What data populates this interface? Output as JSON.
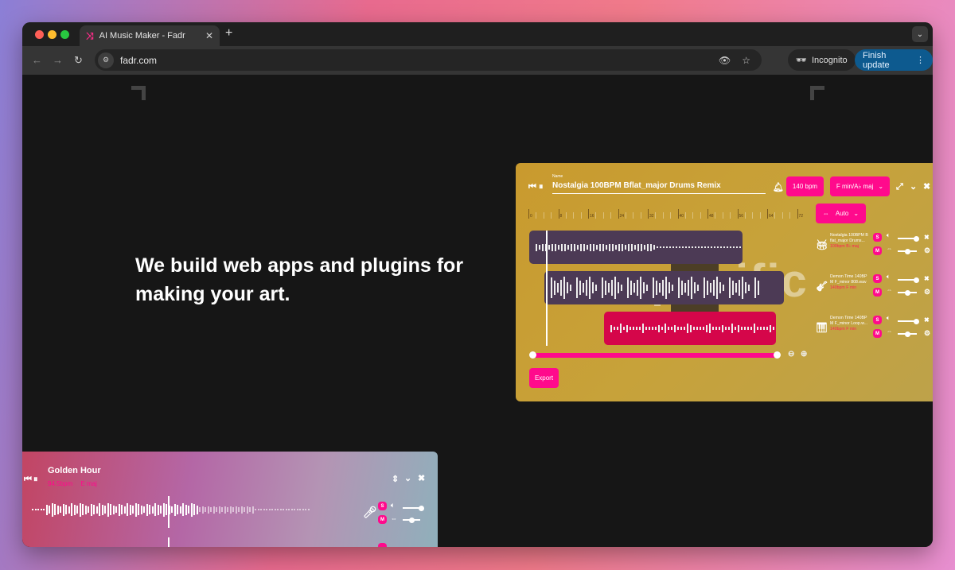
{
  "browser": {
    "tab_title": "AI Music Maker - Fadr",
    "favicon": "fadr-logo-icon",
    "new_tab_label": "+",
    "url": "fadr.com",
    "incognito_label": "Incognito",
    "finish_update_label": "Finish update",
    "icons": [
      "back-arrow-icon",
      "forward-arrow-icon",
      "reload-icon",
      "site-settings-icon",
      "eye-off-icon",
      "star-icon",
      "incognito-icon",
      "kebab-menu-icon",
      "tab-search-icon"
    ]
  },
  "hero": {
    "headline": "We build web apps and plugins for making your art."
  },
  "editor": {
    "name_label": "Name",
    "name_value": "Nostalgia 100BPM Bflat_major Drums Remix",
    "bpm_button": "140 bpm",
    "key_select": "F min/A♭ maj",
    "time_mode_select": "Auto",
    "ruler_labels": [
      "0",
      "8",
      "16",
      "24",
      "32",
      "40",
      "48",
      "56",
      "64",
      "72"
    ],
    "background_word": "pacific",
    "export_button": "Export",
    "zoom_range": {
      "start": 0.0,
      "end": 1.0
    },
    "tracks": [
      {
        "name_line1": "Nostalgia 100BPM B",
        "name_line2": "flat_major Drums...",
        "bpm": "100bpm",
        "key": "B♭ maj",
        "icon": "drum-icon",
        "solo": "S",
        "mute": "M",
        "volume": 0.9,
        "pan": 0.5
      },
      {
        "name_line1": "Demon Time 140BP",
        "name_line2": "M F_minor 808.wav",
        "bpm": "140bpm",
        "key": "F min",
        "icon": "808-bass-icon",
        "solo": "S",
        "mute": "M",
        "volume": 0.9,
        "pan": 0.5
      },
      {
        "name_line1": "Demon Time 140BP",
        "name_line2": "M F_minor Loop.w...",
        "bpm": "140bpm",
        "key": "F min",
        "icon": "piano-icon",
        "solo": "S",
        "mute": "M",
        "volume": 0.9,
        "pan": 0.5
      }
    ],
    "colors": {
      "accent": "#ff0a8c",
      "clip_purple": "#4c3a55",
      "clip_red": "#d5064a",
      "card_bg": "#c99a2e"
    }
  },
  "player": {
    "title": "Golden Hour",
    "bpm": "94.5bpm",
    "key": "E maj",
    "solo": "S",
    "mute": "M",
    "volume": 0.9,
    "pan": 0.5,
    "track_icon": "microphone-icon"
  }
}
